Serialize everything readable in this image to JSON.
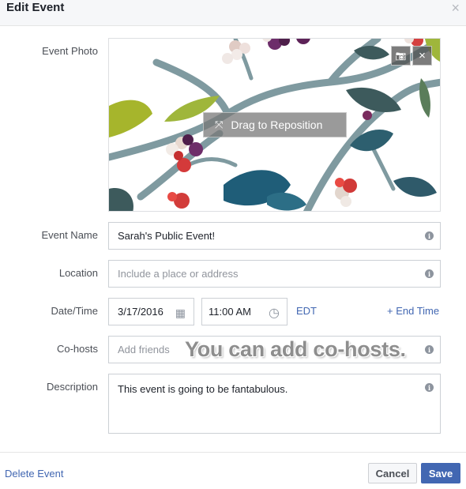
{
  "dialog": {
    "title": "Edit Event",
    "close_glyph": "×"
  },
  "photo": {
    "label": "Event Photo",
    "drag_label": "Drag to Reposition",
    "camera_glyph": "📷",
    "remove_glyph": "×",
    "drag_glyph": "⤧"
  },
  "fields": {
    "event_name": {
      "label": "Event Name",
      "value": "Sarah's Public Event!"
    },
    "location": {
      "label": "Location",
      "placeholder": "Include a place or address"
    },
    "datetime": {
      "label": "Date/Time",
      "date": "3/17/2016",
      "time": "11:00 AM",
      "timezone": "EDT",
      "end_time_link": "+ End Time"
    },
    "cohosts": {
      "label": "Co-hosts",
      "placeholder": "Add friends"
    },
    "description": {
      "label": "Description",
      "value": "This event is going to be fantabulous."
    }
  },
  "annotation": "You can add co-hosts.",
  "footer": {
    "delete_label": "Delete Event",
    "cancel_label": "Cancel",
    "save_label": "Save"
  },
  "icons": {
    "info": "i",
    "calendar": "▦",
    "clock": "◷"
  },
  "colors": {
    "accent": "#4267b2",
    "header_bg": "#f6f7f9",
    "border": "#ccd0d5"
  }
}
